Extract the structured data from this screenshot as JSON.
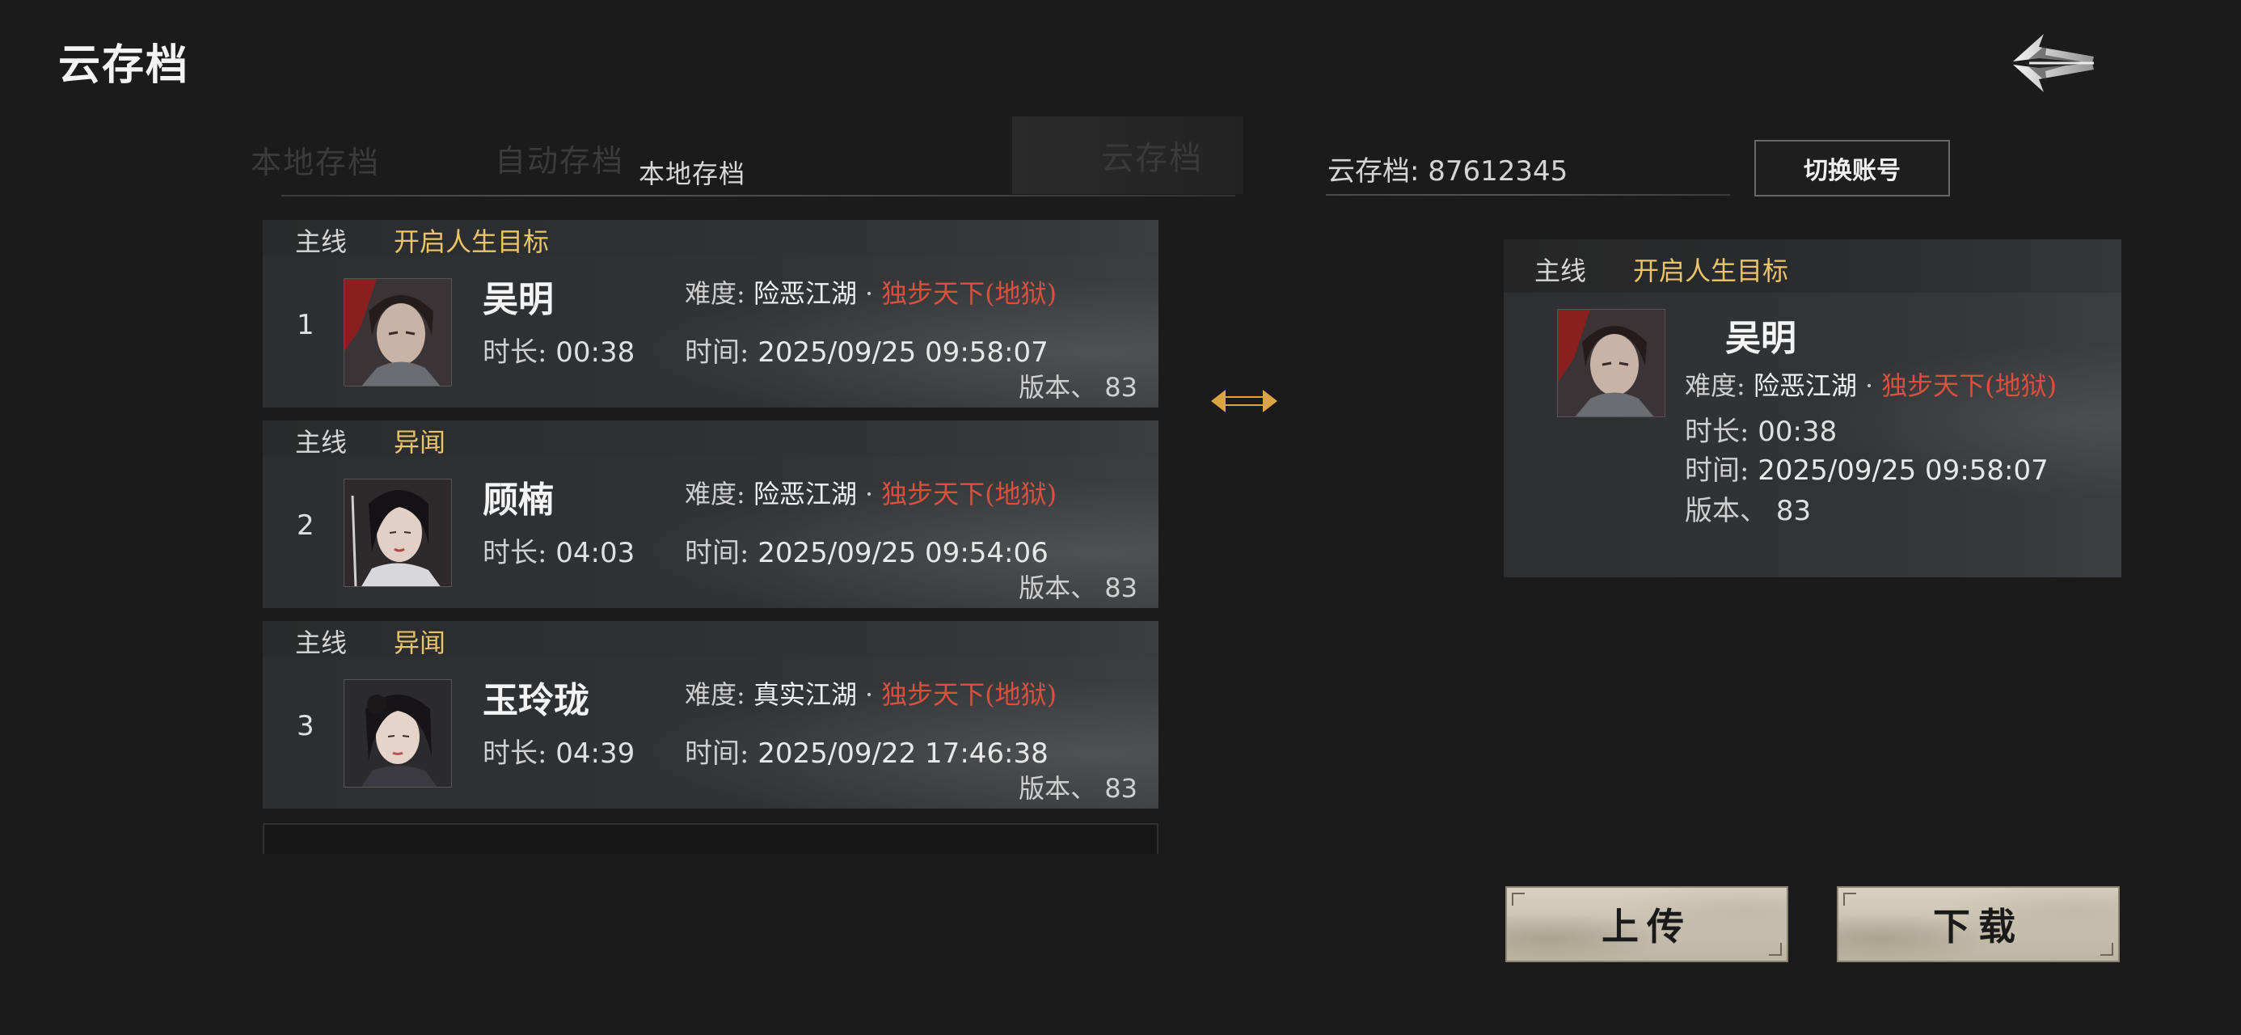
{
  "header": {
    "title": "云存档"
  },
  "tabs": {
    "local_faded": "本地存档",
    "auto": "自动存档",
    "local_active": "本地存档",
    "cloud": "云存档"
  },
  "account": {
    "label": "云存档: 87612345",
    "switch_button": "切换账号"
  },
  "save_slots": [
    {
      "index": "1",
      "line_tag": "主线",
      "goal": "开启人生目标",
      "name": "吴明",
      "difficulty_key": "难度:",
      "difficulty": "险恶江湖",
      "dot": "·",
      "mode": "独步天下(地狱)",
      "duration_key": "时长:",
      "duration": "00:38",
      "time_key": "时间:",
      "time": "2025/09/25 09:58:07",
      "version_key": "版本、",
      "version": "83"
    },
    {
      "index": "2",
      "line_tag": "主线",
      "goal": "异闻",
      "name": "顾楠",
      "difficulty_key": "难度:",
      "difficulty": "险恶江湖",
      "dot": "·",
      "mode": "独步天下(地狱)",
      "duration_key": "时长:",
      "duration": "04:03",
      "time_key": "时间:",
      "time": "2025/09/25 09:54:06",
      "version_key": "版本、",
      "version": "83"
    },
    {
      "index": "3",
      "line_tag": "主线",
      "goal": "异闻",
      "name": "玉玲珑",
      "difficulty_key": "难度:",
      "difficulty": "真实江湖",
      "dot": "·",
      "mode": "独步天下(地狱)",
      "duration_key": "时长:",
      "duration": "04:39",
      "time_key": "时间:",
      "time": "2025/09/22 17:46:38",
      "version_key": "版本、",
      "version": "83"
    }
  ],
  "cloud_save": {
    "line_tag": "主线",
    "goal": "开启人生目标",
    "name": "吴明",
    "difficulty_key": "难度:",
    "difficulty": "险恶江湖",
    "dot": "·",
    "mode": "独步天下(地狱)",
    "duration_key": "时长:",
    "duration": "00:38",
    "time_key": "时间:",
    "time": "2025/09/25 09:58:07",
    "version_key": "版本、",
    "version": "83"
  },
  "actions": {
    "upload": "上传",
    "download": "下载"
  },
  "icons": {
    "back": "back-arrow-icon",
    "transfer": "double-arrow-icon",
    "accent_gold": "#e9c46a",
    "accent_red": "#d9503f"
  }
}
